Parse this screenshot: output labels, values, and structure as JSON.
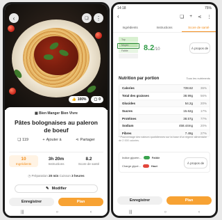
{
  "left": {
    "status": {
      "time": "",
      "battery": ""
    },
    "hero": {
      "score_badge": "100%",
      "comments": "0"
    },
    "brand": "Bien Manger Bien Vivre",
    "title": "Pâtes bolognaises au paleron de boeuf",
    "actions": {
      "count": "119",
      "add": "Ajouter à",
      "share": "Partager"
    },
    "stats": [
      {
        "value": "10",
        "label": "Ingrédients"
      },
      {
        "value": "3h 20m",
        "label": "Instructions"
      },
      {
        "value": "8.2",
        "label": "Score de santé"
      }
    ],
    "times": {
      "prep_label": "Préparation",
      "prep": "20 min",
      "cook_label": "Cuisson",
      "cook": "3 heures"
    },
    "modify": "Modifier",
    "save": "Enregistrer",
    "plan": "Plan"
  },
  "right": {
    "status": {
      "time": "14:18",
      "battery": "75%"
    },
    "tabs": [
      "Ingrédients",
      "Instructions",
      "Score de santé"
    ],
    "health": {
      "levels": [
        "Top",
        "Moyen",
        "Faible",
        ""
      ],
      "score": "8.2",
      "score_max": "/10",
      "about": "À propos de"
    },
    "nutrition_title": "Nutrition par portion",
    "nutrition_link": "Tous les nutriments",
    "nutrition": [
      {
        "name": "Calories",
        "qty": "728.62",
        "pct": "36%"
      },
      {
        "name": "Total des graisses",
        "qty": "38.99g",
        "pct": "56%"
      },
      {
        "name": "Glucides",
        "qty": "54.2g",
        "pct": "20%"
      },
      {
        "name": "Sucres",
        "qty": "15.62g",
        "pct": "17%"
      },
      {
        "name": "Protéines",
        "qty": "38.57g",
        "pct": "77%"
      },
      {
        "name": "Sodium",
        "qty": "458.44mg",
        "pct": "20%"
      },
      {
        "name": "Fibres",
        "qty": "7.49g",
        "pct": "27%"
      }
    ],
    "note": "* Pourcentage des valeurs quotidiennes sur la base d'un régime alimentaire de 2 000 calories.",
    "glycemic": {
      "index_label": "Indice glycém...",
      "index_value": "Faible",
      "load_label": "Charge glycé...",
      "load_value": "Haut",
      "about": "À propos de"
    },
    "save": "Enregistrer",
    "plan": "Plan"
  },
  "colors": {
    "accent": "#f7a233",
    "health_green": "#2e9a45"
  }
}
